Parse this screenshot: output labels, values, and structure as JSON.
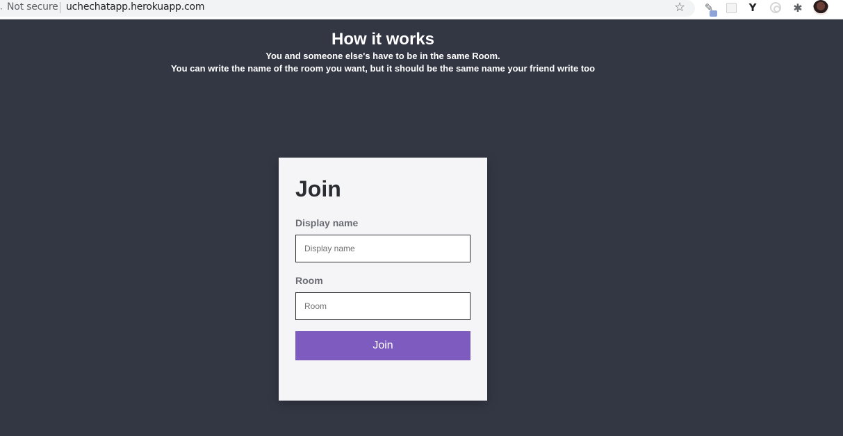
{
  "browser": {
    "security_label": "Not secure",
    "url": "uchechatapp.herokuapp.com",
    "icons": [
      "star-icon",
      "pin-extension-icon",
      "grid-extension-icon",
      "y-extension-icon",
      "target-extension-icon",
      "puzzle-extension-icon",
      "avatar",
      "menu-icon"
    ],
    "y_extension_label": "Y"
  },
  "info": {
    "title": "How it works",
    "line1": "You and someone else's have to be in the same Room.",
    "line2": "You can write the name of the room you want, but it should be the same name your friend write too"
  },
  "form": {
    "heading": "Join",
    "name_label": "Display name",
    "name_placeholder": "Display name",
    "name_value": "",
    "room_label": "Room",
    "room_placeholder": "Room",
    "room_value": "",
    "submit_label": "Join"
  },
  "colors": {
    "background": "#333744",
    "card": "#f5f5f8",
    "button": "#7e5bbe",
    "button_text": "#ffffff"
  }
}
